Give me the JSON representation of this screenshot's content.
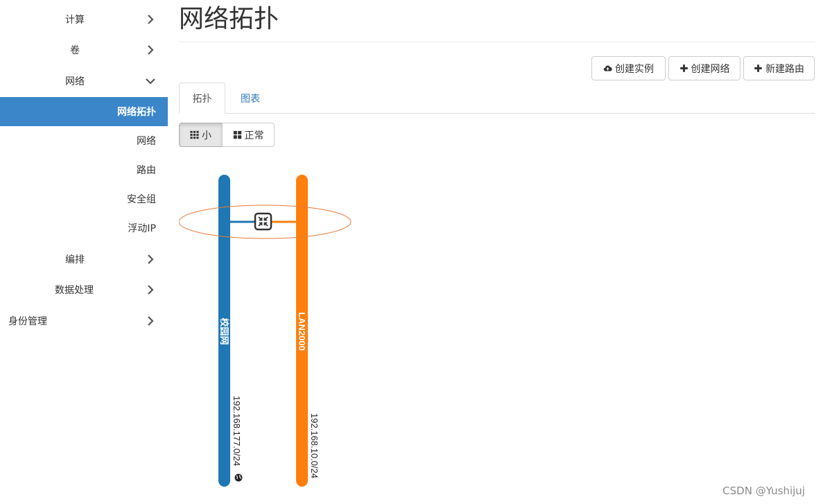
{
  "sidebar": {
    "items": [
      {
        "label": "计算",
        "chevron": "right"
      },
      {
        "label": "卷",
        "chevron": "right"
      },
      {
        "label": "网络",
        "chevron": "down"
      },
      {
        "label": "编排",
        "chevron": "right"
      },
      {
        "label": "数据处理",
        "chevron": "right"
      },
      {
        "label": "身份管理",
        "chevron": "right"
      }
    ],
    "network_subitems": [
      {
        "label": "网络拓扑",
        "active": true
      },
      {
        "label": "网络"
      },
      {
        "label": "路由"
      },
      {
        "label": "安全组"
      },
      {
        "label": "浮动IP"
      }
    ]
  },
  "page": {
    "title": "网络拓扑"
  },
  "actions": {
    "create_instance": "创建实例",
    "create_network": "创建网络",
    "create_router": "新建路由"
  },
  "tabs": {
    "topology": "拓扑",
    "graph": "图表"
  },
  "view_toggle": {
    "small": "小",
    "normal": "正常"
  },
  "topology": {
    "networks": [
      {
        "name": "校园网",
        "cidr": "192.168.177.0/24",
        "color": "#1f77b4",
        "external": true
      },
      {
        "name": "LAN2000",
        "cidr": "192.168.10.0/24",
        "color": "#ff7f0e",
        "external": false
      }
    ],
    "router_icon": "router-icon",
    "highlight_color": "#e87a3a"
  },
  "colors": {
    "accent": "#3a86c8",
    "link": "#337ab7"
  },
  "watermark": "CSDN @Yushijuj"
}
